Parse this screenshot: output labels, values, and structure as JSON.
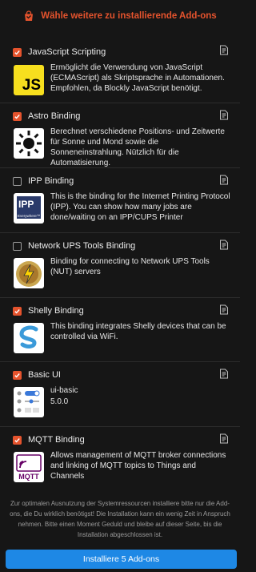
{
  "header": {
    "title": "Wähle weitere zu installierende Add-ons"
  },
  "addons": [
    {
      "name": "JavaScript Scripting",
      "checked": true,
      "logo": "js-logo",
      "description": "Ermöglicht die Verwendung von JavaScript (ECMAScript) als Skriptsprache in Automationen. Empfohlen, da Blockly JavaScript benötigt."
    },
    {
      "name": "Astro Binding",
      "checked": true,
      "logo": "sun-logo",
      "description": "Berechnet verschiedene Positions- und Zeitwerte für Sonne und Mond sowie die Sonneneinstrahlung. Nützlich für die Automatisierung."
    },
    {
      "name": "IPP Binding",
      "checked": false,
      "logo": "ipp-logo",
      "logo_text": {
        "main": "IPP",
        "sub": "Everywhere™"
      },
      "description": "This is the binding for the Internet Printing Protocol (IPP). You can show how many jobs are done/waiting on an IPP/CUPS Printer"
    },
    {
      "name": "Network UPS Tools Binding",
      "checked": false,
      "logo": "nut-logo",
      "description": "Binding for connecting to Network UPS Tools (NUT) servers"
    },
    {
      "name": "Shelly Binding",
      "checked": true,
      "logo": "shelly-logo",
      "description": "This binding integrates Shelly devices that can be controlled via WiFi."
    },
    {
      "name": "Basic UI",
      "checked": true,
      "logo": "basic-ui-logo",
      "id": "ui-basic",
      "version": "5.0.0"
    },
    {
      "name": "MQTT Binding",
      "checked": true,
      "logo": "mqtt-logo",
      "logo_text": "MQTT",
      "description": "Allows management of MQTT broker connections and linking of MQTT topics to Things and Channels"
    }
  ],
  "footer": {
    "note": "Zur optimalen Ausnutzung der Systemressourcen installiere bitte nur die Add-ons, die Du wirklich benötigst! Die Installation kann ein wenig Zeit in Anspruch nehmen. Bitte einen Moment Geduld und bleibe auf dieser Seite, bis die Installation abgeschlossen ist.",
    "button_label": "Installiere 5 Add-ons"
  },
  "colors": {
    "accent": "#e5532d",
    "button": "#1e88e5",
    "background": "#161616"
  }
}
